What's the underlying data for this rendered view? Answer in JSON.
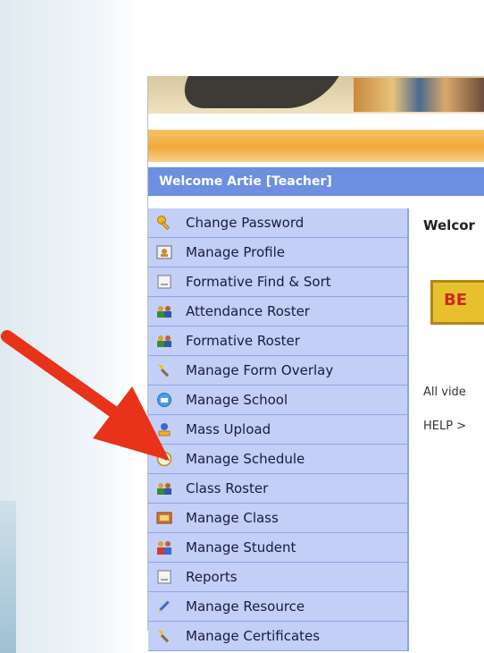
{
  "welcome_bar": "Welcome Artie [Teacher]",
  "menu": [
    {
      "label": "Change Password",
      "icon": "key-icon"
    },
    {
      "label": "Manage Profile",
      "icon": "profile-icon"
    },
    {
      "label": "Formative Find & Sort",
      "icon": "document-icon"
    },
    {
      "label": "Attendance Roster",
      "icon": "people-icon"
    },
    {
      "label": "Formative Roster",
      "icon": "people-icon"
    },
    {
      "label": "Manage Form Overlay",
      "icon": "wand-icon"
    },
    {
      "label": "Manage School",
      "icon": "school-icon"
    },
    {
      "label": "Mass Upload",
      "icon": "upload-icon"
    },
    {
      "label": "Manage Schedule",
      "icon": "clock-icon"
    },
    {
      "label": "Class Roster",
      "icon": "people-icon"
    },
    {
      "label": "Manage Class",
      "icon": "class-icon"
    },
    {
      "label": "Manage Student",
      "icon": "student-icon"
    },
    {
      "label": "Reports",
      "icon": "document-icon"
    },
    {
      "label": "Manage Resource",
      "icon": "pencil-icon"
    },
    {
      "label": "Manage Certificates",
      "icon": "wand-icon"
    }
  ],
  "content": {
    "welcome": "Welcor",
    "begin_button": "BE",
    "videos_text": "All vide",
    "help_text": "HELP >"
  },
  "colors": {
    "menu_bg": "#c3cff7",
    "welcome_bar_bg": "#6c8fe0",
    "arrow": "#e8321a"
  }
}
